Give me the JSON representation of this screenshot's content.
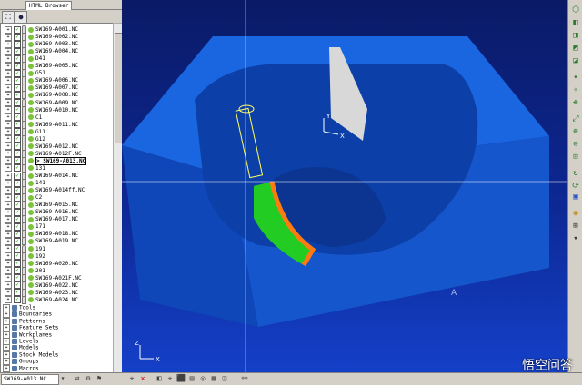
{
  "browser": {
    "tab_label": "HTML Browser"
  },
  "tree": {
    "items": [
      {
        "label": "SW169-A001.NC",
        "type": "toolpath"
      },
      {
        "label": "SW169-A002.NC",
        "type": "toolpath"
      },
      {
        "label": "SW169-A003.NC",
        "type": "toolpath"
      },
      {
        "label": "SW169-A004.NC",
        "type": "toolpath"
      },
      {
        "label": "D41",
        "type": "toolpath"
      },
      {
        "label": "SW169-A005.NC",
        "type": "toolpath"
      },
      {
        "label": "G51",
        "type": "toolpath"
      },
      {
        "label": "SW169-A006.NC",
        "type": "toolpath"
      },
      {
        "label": "SW169-A007.NC",
        "type": "toolpath"
      },
      {
        "label": "SW169-A008.NC",
        "type": "toolpath"
      },
      {
        "label": "SW169-A009.NC",
        "type": "toolpath"
      },
      {
        "label": "SW169-A010.NC",
        "type": "toolpath"
      },
      {
        "label": "C1",
        "type": "toolpath"
      },
      {
        "label": "SW169-A011.NC",
        "type": "toolpath"
      },
      {
        "label": "G11",
        "type": "toolpath"
      },
      {
        "label": "G12",
        "type": "toolpath"
      },
      {
        "label": "SW169-A012.NC",
        "type": "toolpath"
      },
      {
        "label": "SW169-A012F.NC",
        "type": "toolpath"
      },
      {
        "label": "> SW169-A013.NC",
        "type": "toolpath",
        "selected": true
      },
      {
        "label": "131",
        "type": "toolpath"
      },
      {
        "label": "SW169-A014.NC",
        "type": "toolpath"
      },
      {
        "label": "141",
        "type": "toolpath"
      },
      {
        "label": "SW169-A014ff.NC",
        "type": "toolpath"
      },
      {
        "label": "C2",
        "type": "toolpath"
      },
      {
        "label": "SW169-A015.NC",
        "type": "toolpath"
      },
      {
        "label": "SW169-A016.NC",
        "type": "toolpath"
      },
      {
        "label": "SW169-A017.NC",
        "type": "toolpath"
      },
      {
        "label": "171",
        "type": "toolpath"
      },
      {
        "label": "SW169-A018.NC",
        "type": "toolpath"
      },
      {
        "label": "SW169-A019.NC",
        "type": "toolpath"
      },
      {
        "label": "191",
        "type": "toolpath"
      },
      {
        "label": "192",
        "type": "toolpath"
      },
      {
        "label": "SW169-A020.NC",
        "type": "toolpath"
      },
      {
        "label": "201",
        "type": "toolpath"
      },
      {
        "label": "SW169-A021F.NC",
        "type": "toolpath"
      },
      {
        "label": "SW169-A022.NC",
        "type": "toolpath"
      },
      {
        "label": "SW169-A023.NC",
        "type": "toolpath"
      },
      {
        "label": "SW169-A024.NC",
        "type": "toolpath"
      }
    ],
    "folders": [
      {
        "label": "Tools"
      },
      {
        "label": "Boundaries"
      },
      {
        "label": "Patterns"
      },
      {
        "label": "Feature Sets"
      },
      {
        "label": "Workplanes"
      },
      {
        "label": "Levels"
      },
      {
        "label": "Models"
      },
      {
        "label": "Stock Models"
      },
      {
        "label": "Groups"
      },
      {
        "label": "Macros"
      }
    ]
  },
  "viewport": {
    "axis_x": "X",
    "axis_y": "Y",
    "axis_z": "Z",
    "corner_label": "A"
  },
  "status": {
    "active_toolpath": "SW169-A013.NC"
  },
  "watermark": {
    "text": "悟空问答"
  },
  "colors": {
    "part": "#1a66e0",
    "machined_green": "#22cc22",
    "edge_orange": "#ff7a10",
    "background_top": "#0a1a66"
  }
}
